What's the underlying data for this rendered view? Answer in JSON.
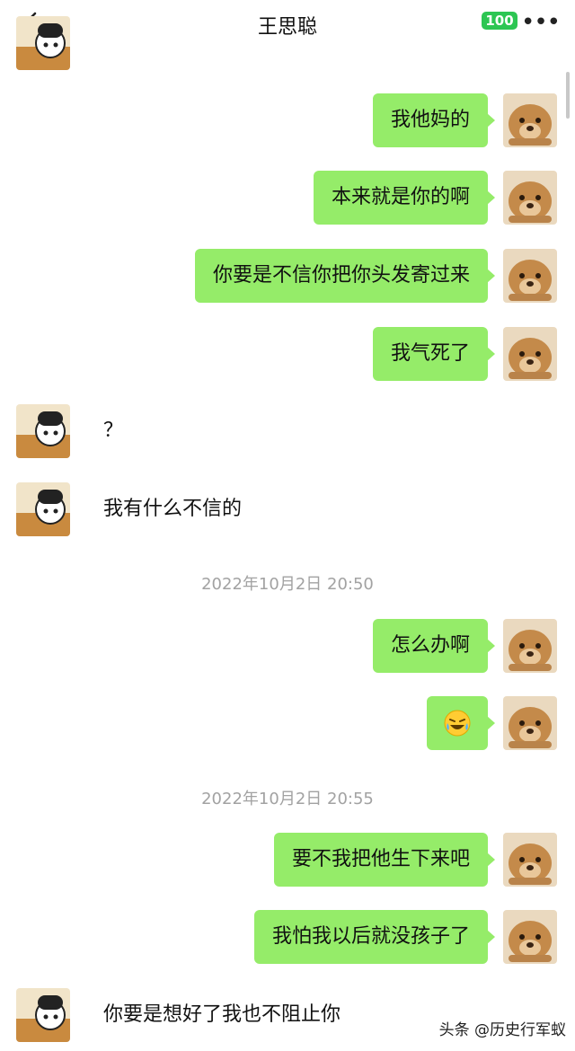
{
  "header": {
    "title": "王思聪",
    "badge": "100"
  },
  "messages": [
    {
      "side": "out",
      "text": "我他妈的"
    },
    {
      "side": "out",
      "text": "本来就是你的啊"
    },
    {
      "side": "out",
      "text": "你要是不信你把你头发寄过来"
    },
    {
      "side": "out",
      "text": "我气死了"
    },
    {
      "side": "in",
      "text": "？"
    },
    {
      "side": "in",
      "text": "我有什么不信的"
    },
    {
      "side": "out",
      "text": "怎么办啊"
    },
    {
      "side": "out",
      "text": "要不我把他生下来吧"
    },
    {
      "side": "out",
      "text": "我怕我以后就没孩子了"
    },
    {
      "side": "in",
      "text": "你要是想好了我也不阻止你"
    }
  ],
  "timestamps": [
    "2022年10月2日 20:50",
    "2022年10月2日 20:55"
  ],
  "emoji_message": {
    "icon": "laughing-crying-emoji"
  },
  "watermark": "头条 @历史行军蚁",
  "colors": {
    "outgoing_bubble": "#95ec69",
    "badge": "#2dc653"
  }
}
